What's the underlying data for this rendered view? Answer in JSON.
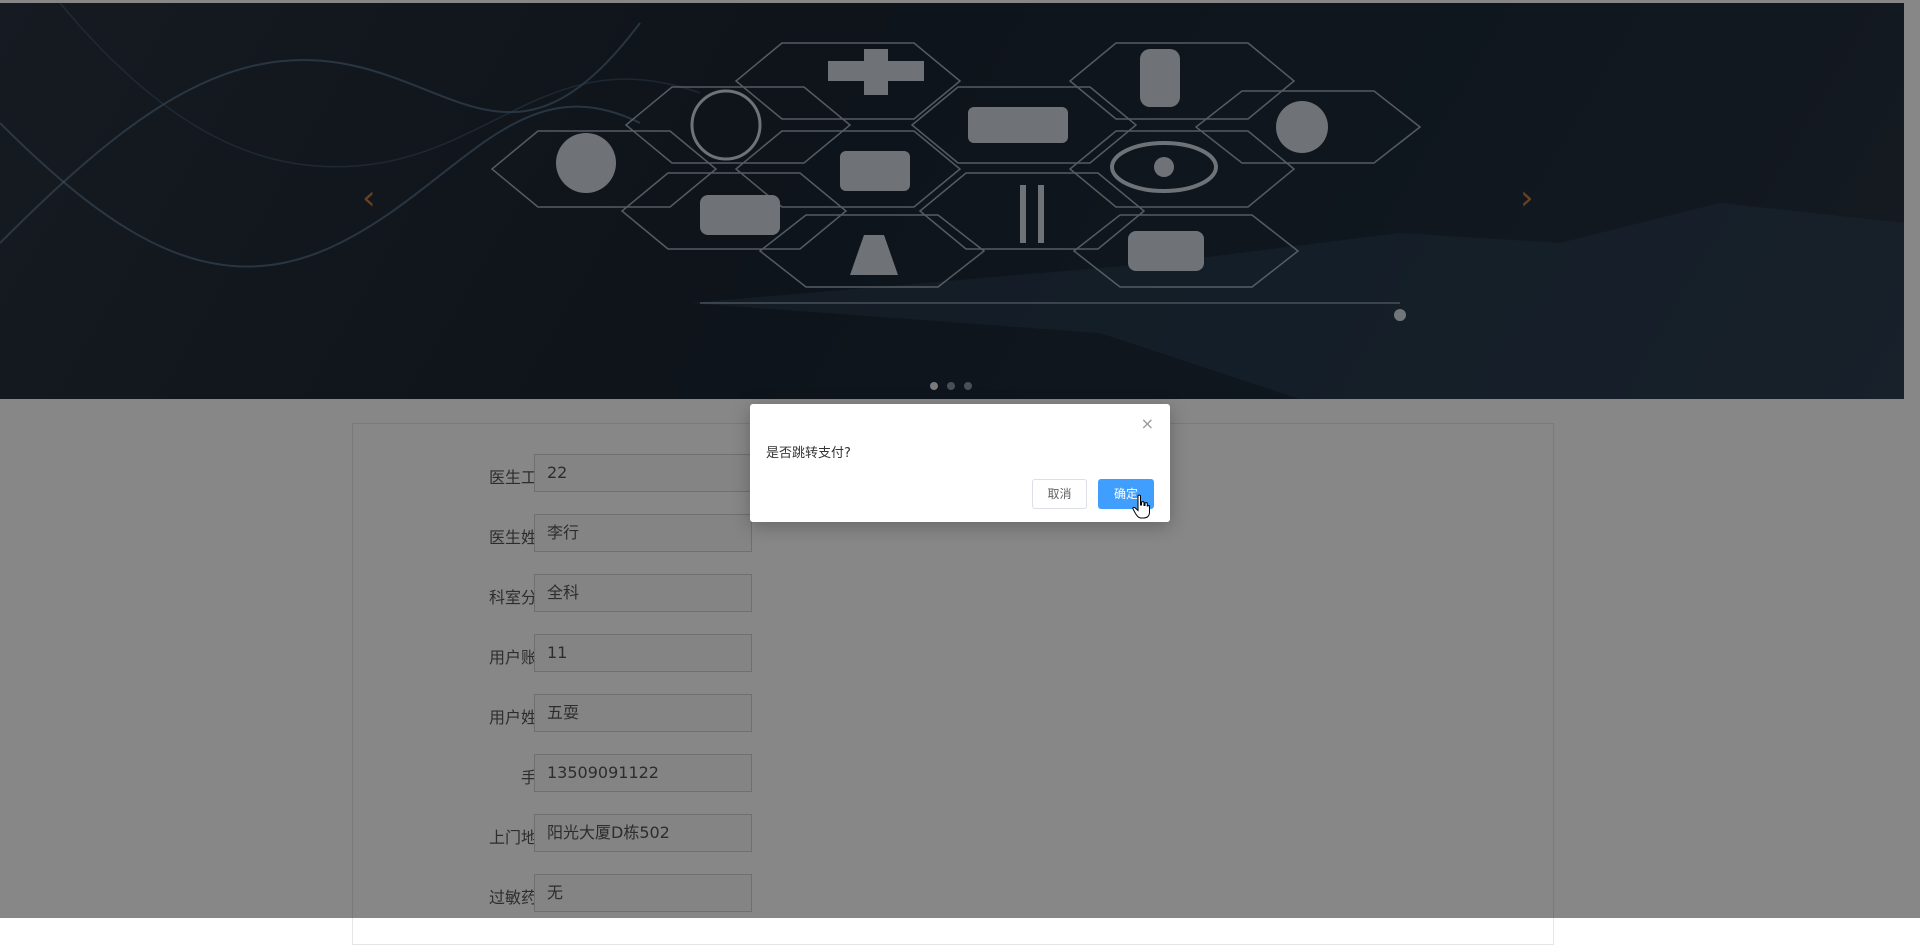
{
  "banner": {
    "prev_arrow": "‹",
    "next_arrow": "›",
    "slides": 3,
    "active_slide": 1
  },
  "form": {
    "fields": [
      {
        "label": "医生工号",
        "value": "22"
      },
      {
        "label": "医生姓名",
        "value": "李行"
      },
      {
        "label": "科室分类",
        "value": "全科"
      },
      {
        "label": "用户账号",
        "value": "11"
      },
      {
        "label": "用户姓名",
        "value": "五耍"
      },
      {
        "label": "手机",
        "value": "13509091122"
      },
      {
        "label": "上门地址",
        "value": "阳光大厦D栋502"
      },
      {
        "label": "过敏药物",
        "value": "无"
      }
    ]
  },
  "dialog": {
    "message": "是否跳转支付?",
    "close_symbol": "×",
    "cancel_label": "取消",
    "ok_label": "确定"
  },
  "colors": {
    "primary": "#409eff",
    "overlay": "rgba(0,0,0,0.47)"
  }
}
